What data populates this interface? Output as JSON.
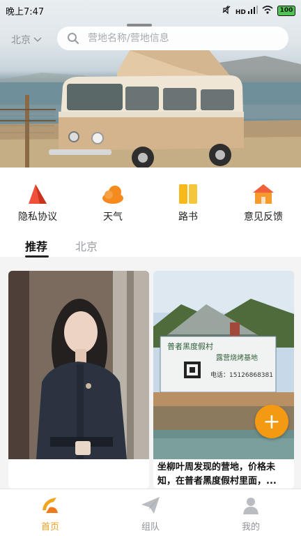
{
  "status_bar": {
    "time": "晚上7:47",
    "network": "HD",
    "battery": "100"
  },
  "header": {
    "city": "北京",
    "search_placeholder": "营地名称/营地信息"
  },
  "quick_menu": [
    {
      "label": "隐私协议",
      "icon": "privacy-icon"
    },
    {
      "label": "天气",
      "icon": "weather-icon"
    },
    {
      "label": "路书",
      "icon": "roadbook-icon"
    },
    {
      "label": "意见反馈",
      "icon": "feedback-icon"
    }
  ],
  "tabs": [
    {
      "label": "推荐",
      "active": true
    },
    {
      "label": "北京",
      "active": false
    }
  ],
  "cards": [
    {
      "title": "",
      "image": "woman-portrait"
    },
    {
      "title": "坐柳叶周发现的营地，价格未知，在普者黑度假村里面，...",
      "image": "campsite-banner",
      "banner": {
        "line1": "普者黑度假村",
        "line2": "露营烧烤基地",
        "phone": "电话：15126868381"
      }
    }
  ],
  "fab": {
    "label": "+"
  },
  "bottom_nav": [
    {
      "label": "首页",
      "icon": "home-icon",
      "active": true
    },
    {
      "label": "组队",
      "icon": "team-icon",
      "active": false
    },
    {
      "label": "我的",
      "icon": "profile-icon",
      "active": false
    }
  ],
  "colors": {
    "accent": "#f49a12",
    "active_nav": "#f0a020",
    "inactive": "#8f9296"
  }
}
